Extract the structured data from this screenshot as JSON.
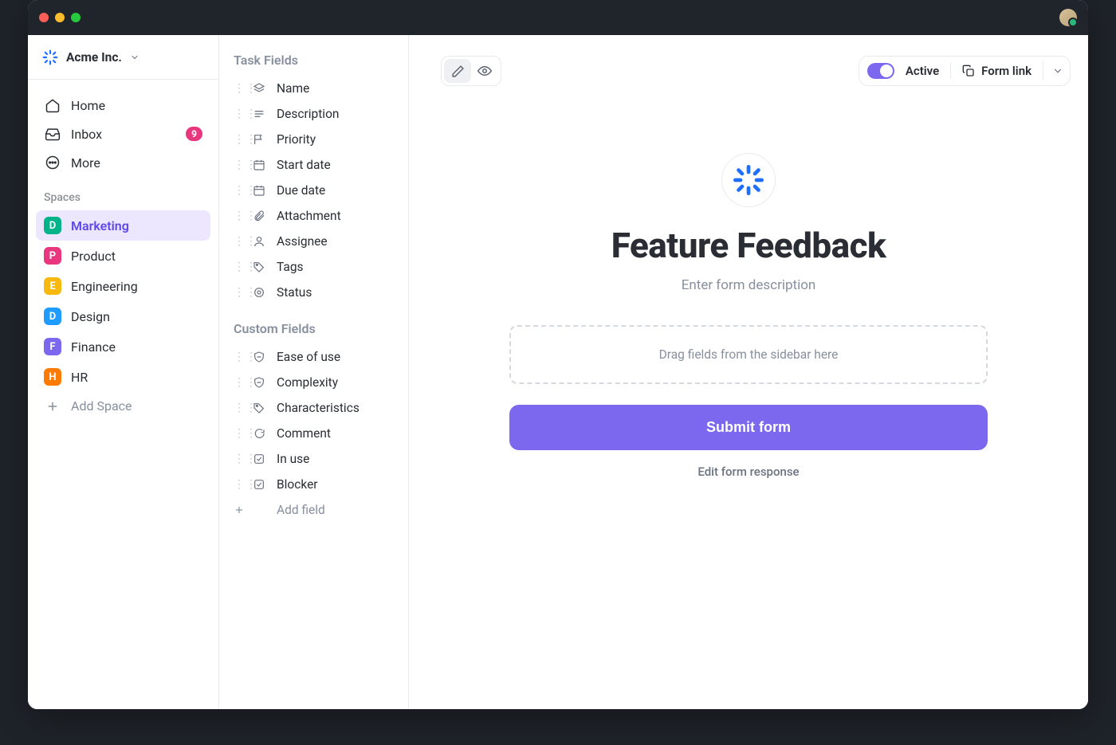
{
  "workspace": {
    "name": "Acme Inc."
  },
  "nav": {
    "home": "Home",
    "inbox": "Inbox",
    "inbox_badge": "9",
    "more": "More"
  },
  "spaces": {
    "label": "Spaces",
    "items": [
      {
        "letter": "D",
        "name": "Marketing",
        "color": "#00b388",
        "active": true
      },
      {
        "letter": "P",
        "name": "Product",
        "color": "#e8367f"
      },
      {
        "letter": "E",
        "name": "Engineering",
        "color": "#f7b90f"
      },
      {
        "letter": "D",
        "name": "Design",
        "color": "#1f9cff"
      },
      {
        "letter": "F",
        "name": "Finance",
        "color": "#7b68ee"
      },
      {
        "letter": "H",
        "name": "HR",
        "color": "#ff7a00"
      }
    ],
    "add": "Add Space"
  },
  "fields_panel": {
    "task_label": "Task Fields",
    "task_fields": [
      {
        "icon": "layers",
        "label": "Name"
      },
      {
        "icon": "lines",
        "label": "Description"
      },
      {
        "icon": "flag",
        "label": "Priority"
      },
      {
        "icon": "date",
        "label": "Start date"
      },
      {
        "icon": "date",
        "label": "Due date"
      },
      {
        "icon": "clip",
        "label": "Attachment"
      },
      {
        "icon": "person",
        "label": "Assignee"
      },
      {
        "icon": "tag",
        "label": "Tags"
      },
      {
        "icon": "target",
        "label": "Status"
      }
    ],
    "custom_label": "Custom Fields",
    "custom_fields": [
      {
        "icon": "shield",
        "label": "Ease of use"
      },
      {
        "icon": "shield",
        "label": "Complexity"
      },
      {
        "icon": "tag",
        "label": "Characteristics"
      },
      {
        "icon": "comment",
        "label": "Comment"
      },
      {
        "icon": "check",
        "label": "In use"
      },
      {
        "icon": "check",
        "label": "Blocker"
      }
    ],
    "add_field": "Add field"
  },
  "toolbar": {
    "active_label": "Active",
    "formlink_label": "Form link"
  },
  "form": {
    "title": "Feature Feedback",
    "description_placeholder": "Enter form description",
    "dropzone": "Drag fields from the sidebar here",
    "submit": "Submit form",
    "edit_response": "Edit form response"
  }
}
